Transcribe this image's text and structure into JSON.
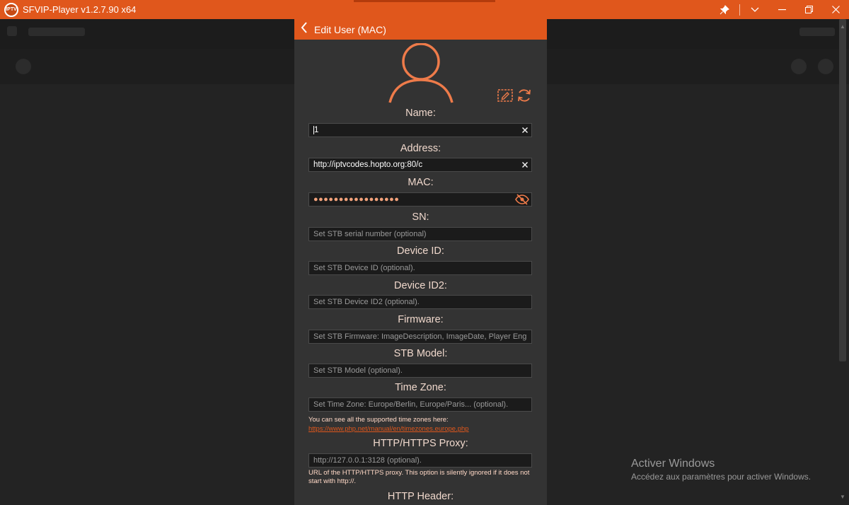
{
  "window": {
    "title": "SFVIP-Player v1.2.7.90 x64",
    "logo_text": "IPTV",
    "controls": {
      "pin": "📌",
      "dropdown": "⌄",
      "minimize": "—",
      "restore": "❐",
      "close": "✕"
    }
  },
  "dialog": {
    "title": "Edit User (MAC)",
    "back_icon": "‹",
    "fields": {
      "name": {
        "label": "Name:",
        "value": "1"
      },
      "address": {
        "label": "Address:",
        "value": "http://iptvcodes.hopto.org:80/c"
      },
      "mac": {
        "label": "MAC:",
        "value": "●●●●●●●●●●●●●●●●●"
      },
      "sn": {
        "label": "SN:",
        "placeholder": "Set STB serial number (optional)"
      },
      "device_id": {
        "label": "Device ID:",
        "placeholder": "Set STB Device ID (optional)."
      },
      "device_id2": {
        "label": "Device ID2:",
        "placeholder": "Set STB Device ID2 (optional)."
      },
      "firmware": {
        "label": "Firmware:",
        "placeholder": "Set STB Firmware: ImageDescription, ImageDate, Player Eng"
      },
      "stb_model": {
        "label": "STB Model:",
        "placeholder": "Set STB Model (optional)."
      },
      "time_zone": {
        "label": "Time Zone:",
        "placeholder": "Set Time Zone: Europe/Berlin, Europe/Paris... (optional).",
        "hint": "You can see all the supported time zones here:",
        "link": "https://www.php.net/manual/en/timezones.europe.php"
      },
      "proxy": {
        "label": "HTTP/HTTPS Proxy:",
        "placeholder": "http://127.0.0.1:3128 (optional).",
        "hint": "URL of the HTTP/HTTPS proxy. This option is silently ignored if it does not start with http://."
      },
      "http_header": {
        "label": "HTTP Header:"
      }
    },
    "clear_icon": "✕"
  },
  "watermark": {
    "title": "Activer Windows",
    "subtitle": "Accédez aux paramètres pour activer Windows."
  },
  "colors": {
    "accent": "#e0571c",
    "dialog_bg": "#333333",
    "field_bg": "#1b1b1b"
  }
}
